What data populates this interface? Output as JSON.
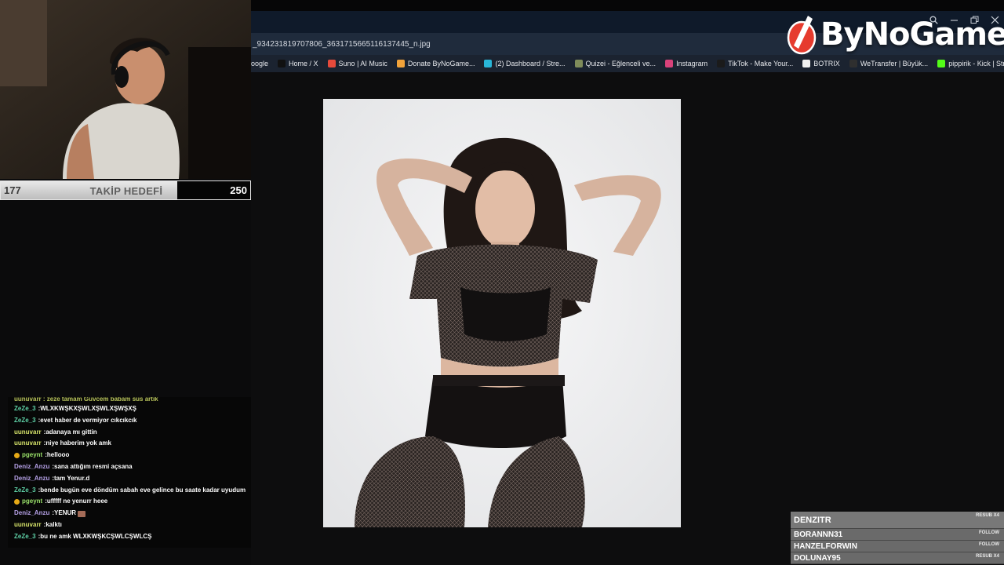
{
  "browser": {
    "url": "_934231819707806_3631715665116137445_n.jpg",
    "bookmarks": [
      {
        "label": "oogle",
        "color": "#4a86f0"
      },
      {
        "label": "Home / X",
        "color": "#111111"
      },
      {
        "label": "Suno | AI Music",
        "color": "#e64a3b"
      },
      {
        "label": "Donate ByNoGame...",
        "color": "#f2a33a"
      },
      {
        "label": "(2) Dashboard / Stre...",
        "color": "#29b6d8"
      },
      {
        "label": "Quizei - Eğlenceli ve...",
        "color": "#7f8c5a"
      },
      {
        "label": "Instagram",
        "color": "#d9427a"
      },
      {
        "label": "TikTok - Make Your...",
        "color": "#1b1b1b"
      },
      {
        "label": "BOTRIX",
        "color": "#f0f0f0"
      },
      {
        "label": "WeTransfer | Büyük...",
        "color": "#2f2f2f"
      },
      {
        "label": "pippirik - Kick | Strea...",
        "color": "#53fc18"
      }
    ],
    "bookmarks_more": "»",
    "window_controls": [
      "search-icon",
      "minimize-icon",
      "restore-icon",
      "close-icon"
    ]
  },
  "brand": {
    "name": "ByNoGame",
    "accent": "#e63b2e"
  },
  "goal": {
    "current": "177",
    "label": "TAKİP HEDEFİ",
    "target": "250",
    "progress_fraction": 0.708
  },
  "chat": {
    "partial_line": "uunuvarr : zeze tamam Güvcem babam sus artık",
    "messages": [
      {
        "user": "ZeZe_3",
        "color": "#5fd3a8",
        "text": "WLXKWŞKXŞWLXŞWLXŞWŞXŞ",
        "badge": false
      },
      {
        "user": "ZeZe_3",
        "color": "#5fd3a8",
        "text": "evet haber de vermiyor cıkcıkcık",
        "badge": false
      },
      {
        "user": "uunuvarr",
        "color": "#d6e36a",
        "text": "adanaya mı gittin",
        "badge": false
      },
      {
        "user": "uunuvarr",
        "color": "#d6e36a",
        "text": "niye haberim yok amk",
        "badge": false
      },
      {
        "user": "pgeynt",
        "color": "#9be26a",
        "text": "hellooo",
        "badge": true
      },
      {
        "user": "Deniz_Anzu",
        "color": "#b5a0e6",
        "text": "sana attığım resmi açsana",
        "badge": false
      },
      {
        "user": "Deniz_Anzu",
        "color": "#b5a0e6",
        "text": "tam Yenur.d",
        "badge": false
      },
      {
        "user": "ZeZe_3",
        "color": "#5fd3a8",
        "text": "bende bugün eve döndüm sabah eve gelince bu saate kadar uyudum",
        "badge": false
      },
      {
        "user": "pgeynt",
        "color": "#9be26a",
        "text": "ufffff ne yenurr heee",
        "badge": true
      },
      {
        "user": "Deniz_Anzu",
        "color": "#b5a0e6",
        "text": "YENUR",
        "badge": false,
        "emote": true
      },
      {
        "user": "uunuvarr",
        "color": "#d6e36a",
        "text": "kalktı",
        "badge": false
      },
      {
        "user": "ZeZe_3",
        "color": "#5fd3a8",
        "text": "bu ne amk WLXKWŞKCŞWLCŞWLCŞ",
        "badge": false
      }
    ]
  },
  "alerts": [
    {
      "name": "DENZITR",
      "tag": "RESUB X4",
      "size": "big"
    },
    {
      "name": "BORANNN31",
      "tag": "FOLLOW",
      "size": "sm"
    },
    {
      "name": "HANZELFORWIN",
      "tag": "FOLLOW",
      "size": "sm"
    },
    {
      "name": "DOLUNAY95",
      "tag": "RESUB X4",
      "size": "sm"
    }
  ]
}
